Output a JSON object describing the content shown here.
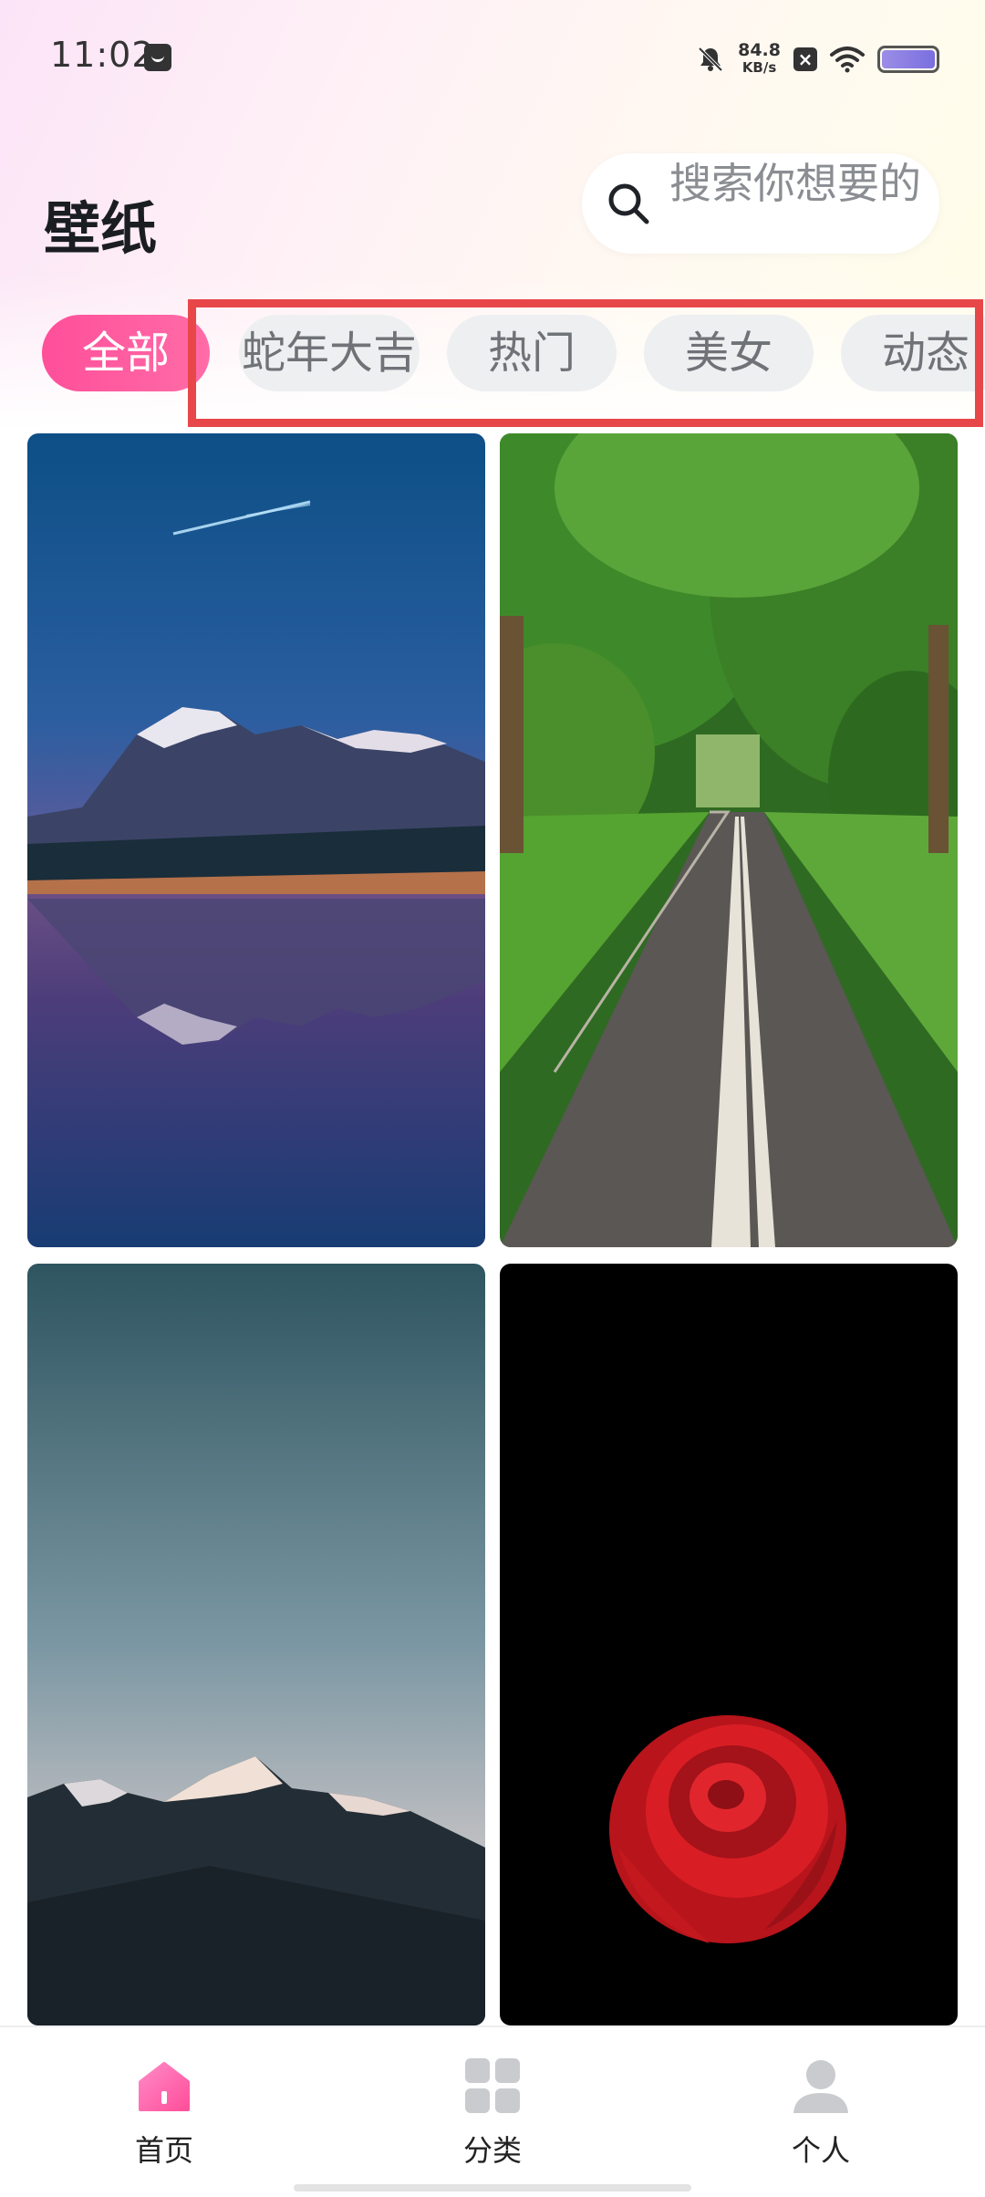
{
  "status_bar": {
    "time": "11:02",
    "net_speed_value": "84.8",
    "net_speed_unit": "KB/s"
  },
  "header": {
    "title": "壁纸",
    "search_placeholder": "搜索你想要的"
  },
  "categories": [
    {
      "label": "全部",
      "active": true
    },
    {
      "label": "蛇年大吉",
      "active": false
    },
    {
      "label": "热门",
      "active": false
    },
    {
      "label": "美女",
      "active": false
    },
    {
      "label": "动态",
      "active": false
    }
  ],
  "wallpapers": [
    {
      "subject": "mountain-lake-sunset"
    },
    {
      "subject": "tree-lined-road"
    },
    {
      "subject": "snowy-peaks-dusk"
    },
    {
      "subject": "red-rose-black"
    }
  ],
  "bottom_nav": [
    {
      "label": "首页",
      "icon": "home-icon",
      "active": true
    },
    {
      "label": "分类",
      "icon": "grid-icon",
      "active": false
    },
    {
      "label": "个人",
      "icon": "person-icon",
      "active": false
    }
  ],
  "colors": {
    "accent": "#ff4f9a",
    "highlight": "#e8474a"
  }
}
